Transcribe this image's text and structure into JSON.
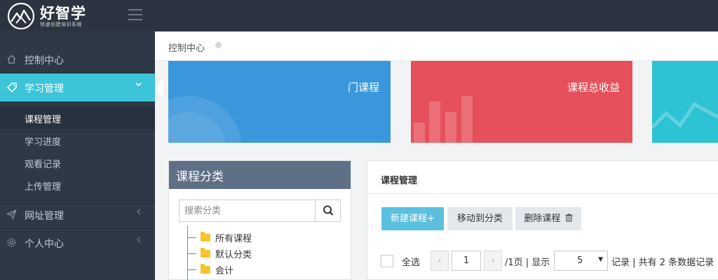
{
  "header": {
    "brand": "好智学",
    "brand_sub": "快速创建培训系统"
  },
  "sidebar": {
    "items": [
      {
        "label": "控制中心",
        "icon": "home-icon"
      },
      {
        "label": "学习管理",
        "icon": "tag-icon",
        "active": true
      },
      {
        "label": "网址管理",
        "icon": "send-icon"
      },
      {
        "label": "个人中心",
        "icon": "gear-icon"
      }
    ],
    "sub_items": [
      {
        "label": "课程管理",
        "current": true
      },
      {
        "label": "学习进度"
      },
      {
        "label": "观看记录"
      },
      {
        "label": "上传管理"
      }
    ]
  },
  "breadcrumb": {
    "label": "控制中心"
  },
  "stats": [
    {
      "title": "门课程",
      "color": "#3a97db"
    },
    {
      "title": "课程总收益",
      "color": "#e6505b"
    },
    {
      "title": "",
      "color": "#2dc3d4"
    }
  ],
  "category": {
    "title": "课程分类",
    "search_placeholder": "搜索分类",
    "tree": [
      "所有课程",
      "默认分类",
      "会计"
    ]
  },
  "course": {
    "title": "课程管理",
    "buttons": {
      "new": "新建课程+",
      "move": "移动到分类",
      "delete": "删除课程"
    },
    "pager": {
      "select_all": "全选",
      "prev": "‹",
      "next": "›",
      "page": "1",
      "per_page_text": "/1页 | 显示",
      "page_size": "5",
      "records_text": "记录 | 共有 2 条数据记录"
    }
  },
  "colors": {
    "topbar": "#2b3440",
    "sidebar": "#2e3947",
    "accent": "#3cc4d8",
    "primary_button": "#5bc0de"
  }
}
